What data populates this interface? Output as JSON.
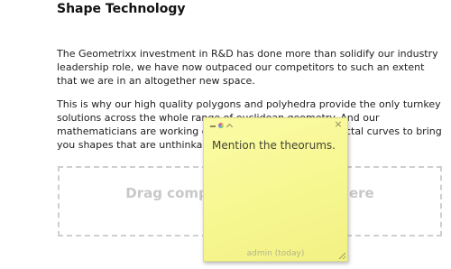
{
  "article": {
    "heading": "Shape Technology",
    "paragraphs": [
      "The Geometrixx investment in R&D has done more than solidify our industry leadership role, we have now outpaced our competitors to such an extent that we are in an altogether new space.",
      "This is why our high quality polygons and polyhedra provide the only turnkey solutions across the whole range of euclidean geometry. And our mathematicians are working on the next generation of fractal curves to bring you shapes that are unthinkable today."
    ]
  },
  "dropzone": {
    "label": "Drag components or assets here"
  },
  "sticky_note": {
    "text": "Mention the theorums.",
    "footer": "admin (today)",
    "close_symbol": "×",
    "toolbar_icons": [
      "minimize-icon",
      "color-icon",
      "chevron-up-icon"
    ],
    "color": "#f9f99c"
  }
}
